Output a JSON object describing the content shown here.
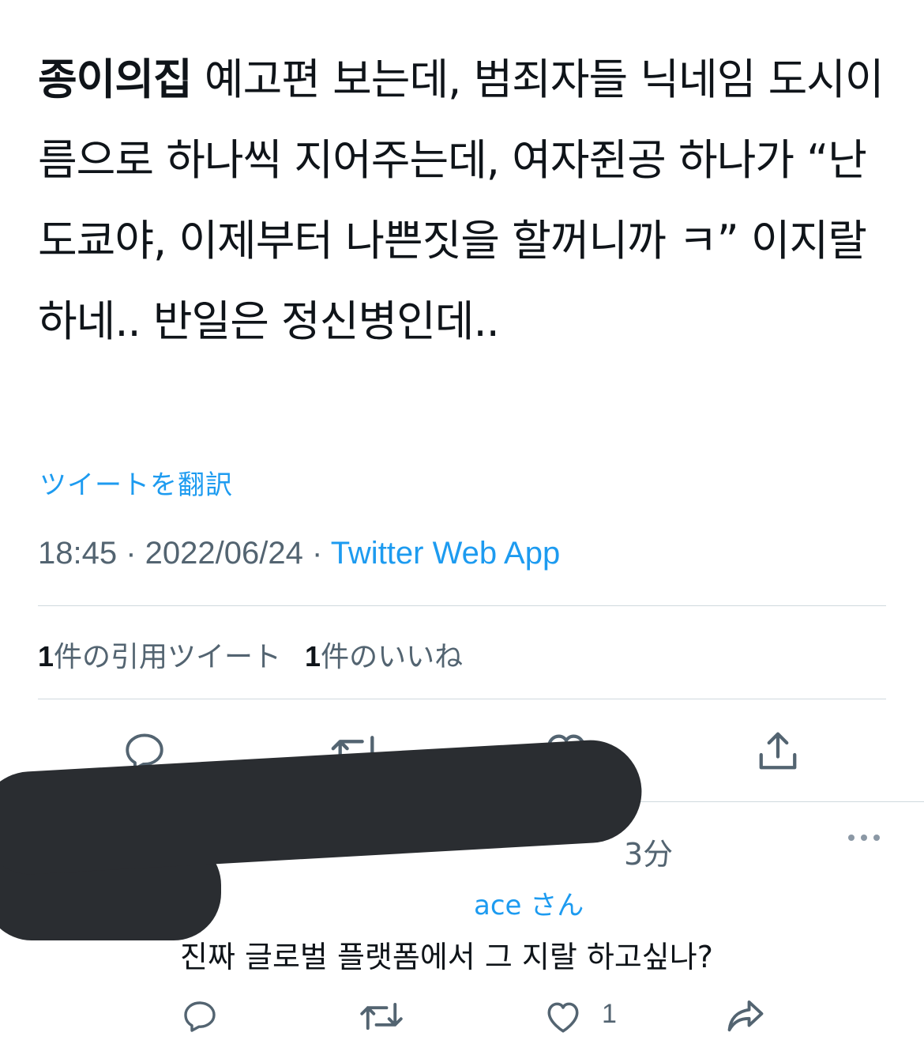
{
  "tweet": {
    "bold_lead": "종이의집",
    "text": " 예고편 보는데, 범죄자들 닉네임 도시이름으로 하나씩 지어주는데, 여자쥔공 하나가 “난 도쿄야, 이제부터 나쁜짓을 할꺼니까 ㅋ” 이지랄하네.. 반일은 정신병인데..",
    "translate_link": "ツイートを翻訳",
    "time": "18:45",
    "date": "2022/06/24",
    "separator": " · ",
    "source_app": "Twitter Web App"
  },
  "stats": {
    "quote_count": "1",
    "quote_label": "件の引用ツイート",
    "like_count": "1",
    "like_label": "件のいいね"
  },
  "actions": {
    "reply_icon": "reply-icon",
    "retweet_icon": "retweet-icon",
    "like_icon": "heart-icon",
    "share_icon": "share-icon"
  },
  "reply": {
    "time_ago": "3分",
    "handle_fragment": "ace さん",
    "body": "진짜 글로벌 플랫폼에서 그 지랄 하고싶나?",
    "like_count": "1",
    "icons": [
      "reply-icon",
      "retweet-icon",
      "heart-icon",
      "share-forward-icon"
    ]
  },
  "colors": {
    "accent": "#1d9bf0",
    "muted": "#536471",
    "text": "#0f1419",
    "divider": "#cfd9de",
    "redaction": "#2a2d31"
  }
}
